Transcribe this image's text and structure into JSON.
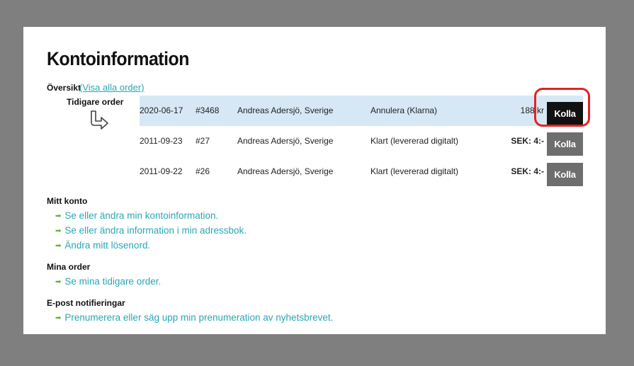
{
  "page": {
    "title": "Kontoinformation",
    "overview_label": "Översikt",
    "overview_link": "(Visa alla order)",
    "previous_orders_label": "Tidigare order"
  },
  "orders": [
    {
      "date": "2020-06-17",
      "number": "#3468",
      "name": "Andreas Adersjö, Sverige",
      "status": "Annulera (Klarna)",
      "amount": "188 kr",
      "button": "Kolla",
      "highlighted": true
    },
    {
      "date": "2011-09-23",
      "number": "#27",
      "name": "Andreas Adersjö, Sverige",
      "status": "Klart (levererad digitalt)",
      "amount": "SEK: 4:-",
      "button": "Kolla",
      "highlighted": false
    },
    {
      "date": "2011-09-22",
      "number": "#26",
      "name": "Andreas Adersjö, Sverige",
      "status": "Klart (levererad digitalt)",
      "amount": "SEK: 4:-",
      "button": "Kolla",
      "highlighted": false
    }
  ],
  "sections": {
    "my_account": {
      "title": "Mitt konto",
      "links": [
        "Se eller ändra min kontoinformation.",
        "Se eller ändra information i min adressbok.",
        "Ändra mitt lösenord."
      ]
    },
    "my_orders": {
      "title": "Mina order",
      "links": [
        "Se mina tidigare order."
      ]
    },
    "email_notifications": {
      "title": "E-post notifieringar",
      "links": [
        "Prenumerera eller säg upp min prenumeration av nyhetsbrevet."
      ]
    }
  },
  "icons": {
    "bullet": "arrow-right-icon",
    "pointer": "curved-arrow-icon"
  },
  "colors": {
    "link": "#2aa7b4",
    "bullet": "#5cb531",
    "highlight_row": "#d6e8f5",
    "annotation": "#e52222"
  }
}
